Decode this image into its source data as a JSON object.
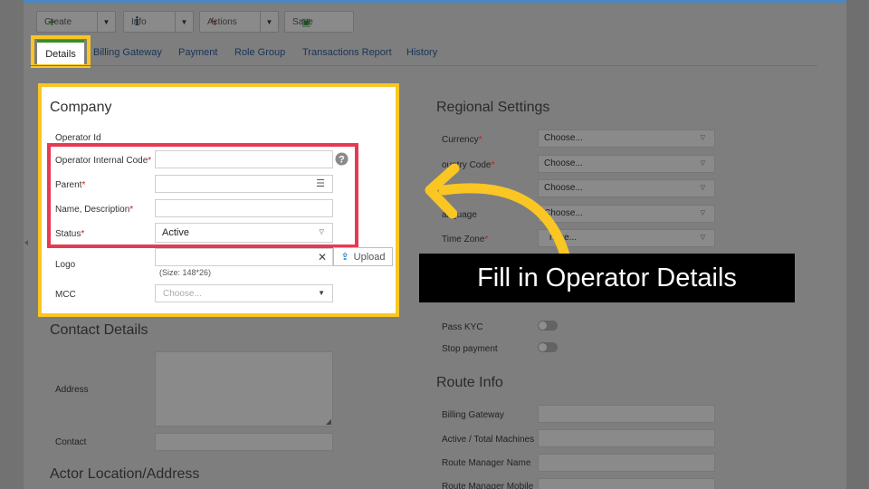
{
  "toolbar": {
    "create_label": "Create",
    "info_label": "Info",
    "actions_label": "Actions",
    "save_label": "Save"
  },
  "tabs": [
    {
      "label": "Details"
    },
    {
      "label": "Billing Gateway"
    },
    {
      "label": "Payment"
    },
    {
      "label": "Role Group"
    },
    {
      "label": "Transactions Report"
    },
    {
      "label": "History"
    }
  ],
  "company": {
    "title": "Company",
    "operator_id_label": "Operator Id",
    "internal_code_label": "Operator Internal Code",
    "parent_label": "Parent",
    "name_label": "Name, Description",
    "status_label": "Status",
    "status_value": "Active",
    "logo_label": "Logo",
    "upload_label": "Upload",
    "logo_hint": "(Size: 148*26)",
    "mcc_label": "MCC",
    "mcc_placeholder": "Choose...",
    "required_mark": "*"
  },
  "contact": {
    "title": "Contact Details",
    "address_label": "Address",
    "contact_label": "Contact"
  },
  "actor": {
    "title": "Actor Location/Address"
  },
  "regional": {
    "title": "Regional Settings",
    "rows": [
      {
        "label": "Currency",
        "value": "Choose..."
      },
      {
        "label": "ountry Code",
        "value": "Choose..."
      },
      {
        "label": "",
        "value": "Choose..."
      },
      {
        "label": "anguage",
        "value": "Choose..."
      },
      {
        "label": "Time Zone",
        "value": "nose..."
      }
    ]
  },
  "toggles": {
    "pass_kyc_label": "Pass KYC",
    "stop_payment_label": "Stop payment"
  },
  "route": {
    "title": "Route Info",
    "fields": [
      {
        "label": "Billing Gateway"
      },
      {
        "label": "Active / Total Machines"
      },
      {
        "label": "Route Manager Name"
      },
      {
        "label": "Route Manager Mobile"
      }
    ]
  },
  "overlay": {
    "callout_text": "Fill in Operator Details"
  },
  "colors": {
    "highlight_yellow": "#f9c623",
    "highlight_red": "#e63a52",
    "active_tab_green": "#3a8b2b",
    "window_top_blue": "#4b88c3",
    "callout_bg": "#000000"
  }
}
